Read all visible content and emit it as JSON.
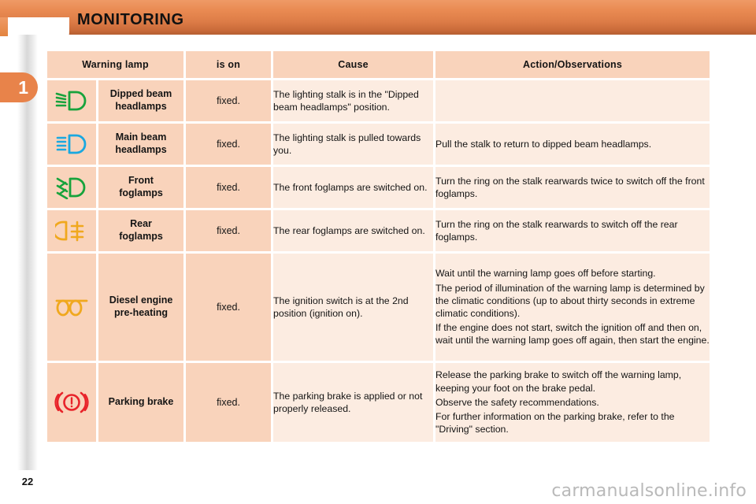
{
  "header": {
    "title": "MONITORING",
    "chapter_number": "1"
  },
  "table": {
    "columns": [
      {
        "label": "Warning lamp",
        "name": "warning-lamp"
      },
      {
        "label": "is on",
        "name": "is-on"
      },
      {
        "label": "Cause",
        "name": "cause"
      },
      {
        "label": "Action/Observations",
        "name": "action-observations"
      }
    ],
    "rows": [
      {
        "icon": "dipped-beam-headlamp-icon",
        "icon_color": "#17a33c",
        "lamp": "Dipped beam\nheadlamps",
        "lamp_line1": "Dipped beam",
        "lamp_line2": "headlamps",
        "is_on": "fixed.",
        "cause": [
          "The lighting stalk is in the",
          "\"Dipped beam headlamps\"",
          "position."
        ],
        "cause_text": "The lighting stalk is in the \"Dipped beam headlamps\" position.",
        "action": [],
        "action_text": ""
      },
      {
        "icon": "main-beam-headlamp-icon",
        "icon_color": "#1aa8e0",
        "lamp_line1": "Main beam",
        "lamp_line2": "headlamps",
        "is_on": "fixed.",
        "cause_text": "The lighting stalk is pulled towards you.",
        "action_text": "Pull the stalk to return to dipped beam headlamps."
      },
      {
        "icon": "front-foglamp-icon",
        "icon_color": "#17a33c",
        "lamp_line1": "Front",
        "lamp_line2": "foglamps",
        "is_on": "fixed.",
        "cause_text": "The front foglamps are switched on.",
        "action_text": "Turn the ring on the stalk rearwards twice to switch off the front foglamps."
      },
      {
        "icon": "rear-foglamp-icon",
        "icon_color": "#f0a81e",
        "lamp_line1": "Rear",
        "lamp_line2": "foglamps",
        "is_on": "fixed.",
        "cause_text": "The rear foglamps are switched on.",
        "action_text": "Turn the ring on the stalk rearwards to switch off the rear foglamps."
      },
      {
        "icon": "diesel-preheating-icon",
        "icon_color": "#f0a81e",
        "lamp_line1": "Diesel engine",
        "lamp_line2": "pre-heating",
        "is_on": "fixed.",
        "cause_text": "The  ignition  switch  is  at  the 2nd position (ignition on).",
        "action_p1": "Wait until the warning lamp goes off before starting.",
        "action_p2": "The period of illumination of the warning lamp is determined by the climatic conditions (up to about thirty seconds in extreme climatic conditions).",
        "action_p3": "If the engine does not start, switch the ignition off and then on, wait until the warning lamp goes off again, then start the engine."
      },
      {
        "icon": "parking-brake-icon",
        "icon_color": "#e8232a",
        "lamp_line1": "Parking brake",
        "lamp_line2": "",
        "is_on": "fixed.",
        "cause_text": "The parking brake is applied or not properly released.",
        "action_p1": "Release the parking brake to switch off the warning lamp, keeping your foot on the brake pedal.",
        "action_p2": "Observe the safety recommendations.",
        "action_p3": "For further information on the parking brake, refer to the \"Driving\" section."
      }
    ]
  },
  "footer": {
    "page_number": "22",
    "watermark": "carmanualsonline.info"
  },
  "colors": {
    "banner_orange": "#e3843f",
    "cell_dark": "#f9d3bb",
    "cell_light": "#fcece1",
    "green": "#17a33c",
    "blue": "#1aa8e0",
    "amber": "#f0a81e",
    "red": "#e8232a"
  }
}
